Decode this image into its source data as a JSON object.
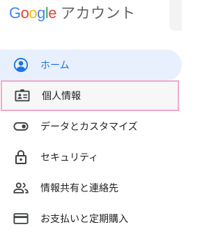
{
  "header": {
    "logo_letters": [
      {
        "char": "G",
        "color": "#4285F4"
      },
      {
        "char": "o",
        "color": "#EA4335"
      },
      {
        "char": "o",
        "color": "#FBBC05"
      },
      {
        "char": "g",
        "color": "#4285F4"
      },
      {
        "char": "l",
        "color": "#34A853"
      },
      {
        "char": "e",
        "color": "#EA4335"
      }
    ],
    "product_name": "アカウント"
  },
  "nav": {
    "items": [
      {
        "label": "ホーム",
        "icon": "account-circle-icon",
        "state": "active"
      },
      {
        "label": "個人情報",
        "icon": "id-card-icon",
        "state": "highlighted"
      },
      {
        "label": "データとカスタマイズ",
        "icon": "toggle-icon",
        "state": "normal"
      },
      {
        "label": "セキュリティ",
        "icon": "lock-icon",
        "state": "normal"
      },
      {
        "label": "情報共有と連絡先",
        "icon": "people-icon",
        "state": "normal"
      },
      {
        "label": "お支払いと定期購入",
        "icon": "credit-card-icon",
        "state": "normal"
      }
    ]
  },
  "colors": {
    "accent": "#1a73e8",
    "active_bg": "#e8f0fe",
    "highlight_border": "#f0a9c8",
    "icon_default": "#5f6368",
    "text": "#202124"
  }
}
